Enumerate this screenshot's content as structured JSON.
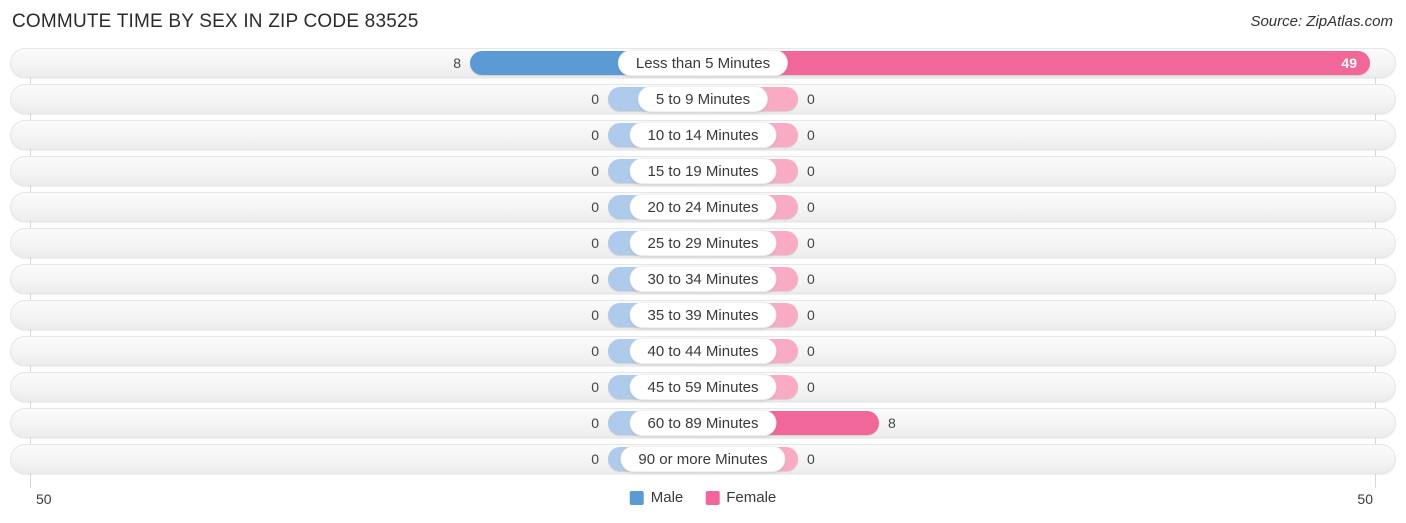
{
  "header": {
    "title": "COMMUTE TIME BY SEX IN ZIP CODE 83525",
    "source": "Source: ZipAtlas.com"
  },
  "legend": {
    "items": [
      {
        "label": "Male",
        "color": "#5b9bd5",
        "icon": "male-swatch"
      },
      {
        "label": "Female",
        "color": "#f2679a",
        "icon": "female-swatch"
      }
    ]
  },
  "axis": {
    "left_tick": "50",
    "right_tick": "50",
    "max": 50
  },
  "colors": {
    "male_strong": "#5b9bd5",
    "male_zero": "#aecbeb",
    "female_strong": "#f2679a",
    "female_zero": "#f9abc4",
    "track": "#f4f4f4",
    "title": "#2b2b2b"
  },
  "chart_data": {
    "type": "bar",
    "title": "COMMUTE TIME BY SEX IN ZIP CODE 83525",
    "subtitle": "Source: ZipAtlas.com",
    "orientation": "horizontal-diverging",
    "xlabel": "",
    "ylabel": "",
    "xlim": [
      50,
      50
    ],
    "grid": false,
    "legend_position": "bottom-center",
    "categories": [
      "Less than 5 Minutes",
      "5 to 9 Minutes",
      "10 to 14 Minutes",
      "15 to 19 Minutes",
      "20 to 24 Minutes",
      "25 to 29 Minutes",
      "30 to 34 Minutes",
      "35 to 39 Minutes",
      "40 to 44 Minutes",
      "45 to 59 Minutes",
      "60 to 89 Minutes",
      "90 or more Minutes"
    ],
    "series": [
      {
        "name": "Male",
        "values": [
          8,
          0,
          0,
          0,
          0,
          0,
          0,
          0,
          0,
          0,
          0,
          0
        ]
      },
      {
        "name": "Female",
        "values": [
          49,
          0,
          0,
          0,
          0,
          0,
          0,
          0,
          0,
          0,
          8,
          0
        ]
      }
    ],
    "value_labels": {
      "male": [
        "8",
        "0",
        "0",
        "0",
        "0",
        "0",
        "0",
        "0",
        "0",
        "0",
        "0",
        "0"
      ],
      "female": [
        "49",
        "0",
        "0",
        "0",
        "0",
        "0",
        "0",
        "0",
        "0",
        "0",
        "8",
        "0"
      ]
    }
  },
  "rows": [
    {
      "label": "Less than 5 Minutes",
      "male": "8",
      "female": "49",
      "male_w": 233,
      "female_w": 667,
      "male_inside": false,
      "female_inside": true
    },
    {
      "label": "5 to 9 Minutes",
      "male": "0",
      "female": "0",
      "male_w": 95,
      "female_w": 95,
      "male_inside": false,
      "female_inside": false
    },
    {
      "label": "10 to 14 Minutes",
      "male": "0",
      "female": "0",
      "male_w": 95,
      "female_w": 95,
      "male_inside": false,
      "female_inside": false
    },
    {
      "label": "15 to 19 Minutes",
      "male": "0",
      "female": "0",
      "male_w": 95,
      "female_w": 95,
      "male_inside": false,
      "female_inside": false
    },
    {
      "label": "20 to 24 Minutes",
      "male": "0",
      "female": "0",
      "male_w": 95,
      "female_w": 95,
      "male_inside": false,
      "female_inside": false
    },
    {
      "label": "25 to 29 Minutes",
      "male": "0",
      "female": "0",
      "male_w": 95,
      "female_w": 95,
      "male_inside": false,
      "female_inside": false
    },
    {
      "label": "30 to 34 Minutes",
      "male": "0",
      "female": "0",
      "male_w": 95,
      "female_w": 95,
      "male_inside": false,
      "female_inside": false
    },
    {
      "label": "35 to 39 Minutes",
      "male": "0",
      "female": "0",
      "male_w": 95,
      "female_w": 95,
      "male_inside": false,
      "female_inside": false
    },
    {
      "label": "40 to 44 Minutes",
      "male": "0",
      "female": "0",
      "male_w": 95,
      "female_w": 95,
      "male_inside": false,
      "female_inside": false
    },
    {
      "label": "45 to 59 Minutes",
      "male": "0",
      "female": "0",
      "male_w": 95,
      "female_w": 95,
      "male_inside": false,
      "female_inside": false
    },
    {
      "label": "60 to 89 Minutes",
      "male": "0",
      "female": "8",
      "male_w": 95,
      "female_w": 176,
      "male_inside": false,
      "female_inside": false
    },
    {
      "label": "90 or more Minutes",
      "male": "0",
      "female": "0",
      "male_w": 95,
      "female_w": 95,
      "male_inside": false,
      "female_inside": false
    }
  ]
}
